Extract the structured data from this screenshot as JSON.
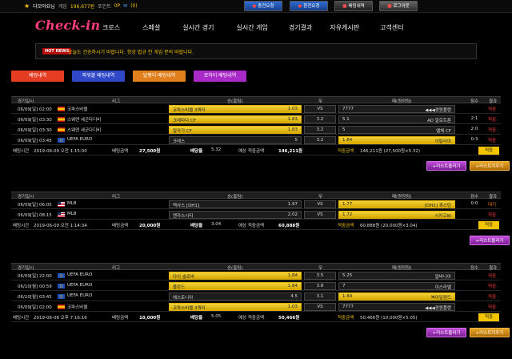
{
  "topbar": {
    "username": "다모아요님",
    "money_label": "게임",
    "money": "196,677원",
    "point_label": "포인트",
    "point": "0P",
    "message_count": "(0)",
    "buttons": {
      "charge": "충전요청",
      "exchange": "환전요청",
      "betlist": "배팅내역",
      "logout": "로그아웃"
    }
  },
  "nav": {
    "logo": "Check-in",
    "menu": [
      "크로스",
      "스페셜",
      "실시간 경기",
      "실시간 게임",
      "경기결과",
      "자유게시판",
      "고객센터"
    ]
  },
  "notice": {
    "tag": "HOT NEWS",
    "text": "오늘도 건승하시기 바랍니다. 항상 법규 전 게임 문의 바랍니다."
  },
  "tabs": [
    "배팅내역",
    "파워볼 배팅내역",
    "달팽이 배팅내역",
    "로하이 배팅내역"
  ],
  "table_headers": {
    "date": "경기일시",
    "league": "리그",
    "home": "승(홈팀)",
    "draw": "무",
    "away": "패(원정팀)",
    "score": "점수",
    "result": "결과"
  },
  "sections": [
    {
      "rows": [
        {
          "date": "06/09[일] 02:00",
          "league": "코파스비렐",
          "home": "코파스비렐 3쿼터",
          "home_odds": "1.03",
          "draw": "VS",
          "away": "7777",
          "away_odds": "",
          "away_team": "◀◀◀경원플랜",
          "pick": "home",
          "score": "",
          "result": "적중"
        },
        {
          "date": "06/09[일] 03:30",
          "league": "스웨덴 세군다디비",
          "home": "크레마다 CF",
          "home_odds": "1.83",
          "draw": "3.2",
          "away": "5.1",
          "away_odds": "",
          "away_team": "AD 알로트룬",
          "pick": "home",
          "score": "2:1",
          "result": "적중"
        },
        {
          "date": "06/09[일] 03:30",
          "league": "스웨덴 세군다디비",
          "home": "말라가 CF",
          "home_odds": "1.83",
          "draw": "3.2",
          "away": "5",
          "away_odds": "",
          "away_team": "엘체 CF",
          "pick": "home",
          "score": "2:0",
          "result": "적중"
        },
        {
          "date": "06/09[일] 03:45",
          "league": "UEFA EURO",
          "home": "크레스",
          "home_odds": "5",
          "draw": "3.2",
          "away": "1.84",
          "away_odds": "",
          "away_team": "이탈리아",
          "pick": "away",
          "score": "0:3",
          "result": "적중"
        }
      ],
      "summary": {
        "bet_time_label": "배팅시간",
        "bet_time": "2019-06-09 오전 1:15:00",
        "amount_label": "배팅금액",
        "amount": "27,500원",
        "odds_label": "배당율",
        "odds": "5.32",
        "expected_label": "예상 적중금액",
        "expected": "146,211원",
        "win_label": "적중금액",
        "win": "146,211원 (27,500원×5.32)",
        "status": "적중"
      },
      "actions": {
        "add": "+리스트올리기",
        "del": "+리스트지우기"
      }
    },
    {
      "rows": [
        {
          "date": "06/09[일] 06:05",
          "league": "MLB",
          "home": "텍사스 [DH1]",
          "home_odds": "1.97",
          "draw": "VS",
          "away": "1.77",
          "away_odds": "",
          "away_team": "[DH1] 휴스턴",
          "pick": "away",
          "score": "0:0",
          "result": "대기"
        },
        {
          "date": "06/09[일] 08:15",
          "league": "MLB",
          "home": "캔자스시티",
          "home_odds": "2.02",
          "draw": "VS",
          "away": "1.72",
          "away_odds": "",
          "away_team": "시카고W",
          "pick": "away",
          "score": "",
          "result": "적중"
        }
      ],
      "summary": {
        "bet_time_label": "배팅시간",
        "bet_time": "2019-06-09 오전 1:14:34",
        "amount_label": "배팅금액",
        "amount": "20,000원",
        "odds_label": "배당율",
        "odds": "3.04",
        "expected_label": "예상 적중금액",
        "expected": "60,888원",
        "win_label": "적중금액",
        "win": "60,888원 (20,000원×3.04)",
        "status": "적중"
      },
      "actions": {
        "add": "+리스트올리기"
      }
    },
    {
      "rows": [
        {
          "date": "06/09[일] 22:00",
          "league": "UEFA EURO",
          "home": "다이 슬로바",
          "home_odds": "1.84",
          "draw": "3.5",
          "away": "5.25",
          "away_odds": "",
          "away_team": "알바니아",
          "pick": "home",
          "score": "",
          "result": "적중"
        },
        {
          "date": "06/10[월] 00:59",
          "league": "UEFA EURO",
          "home": "폴란드",
          "home_odds": "1.84",
          "draw": "3.8",
          "away": "7",
          "away_odds": "",
          "away_team": "이스라엘",
          "pick": "home",
          "score": "",
          "result": "적중"
        },
        {
          "date": "06/10[월] 03:45",
          "league": "UEFA EURO",
          "home": "에스토니아",
          "home_odds": "4.5",
          "draw": "3.1",
          "away": "1.84",
          "away_odds": "",
          "away_team": "북아일랜드",
          "pick": "away",
          "score": "",
          "result": "적중"
        },
        {
          "date": "06/09[일] 02:00",
          "league": "코파스비렐",
          "home": "코파스비렐 3쿼터",
          "home_odds": "1.03",
          "draw": "VS",
          "away": "7777",
          "away_odds": "",
          "away_team": "◀◀◀경원플랜",
          "pick": "home",
          "score": "",
          "result": "적중"
        }
      ],
      "summary": {
        "bet_time_label": "배팅시간",
        "bet_time": "2019-06-08 오후 7:16:16",
        "amount_label": "배팅금액",
        "amount": "10,000원",
        "odds_label": "배당율",
        "odds": "5.05",
        "expected_label": "예상 적중금액",
        "expected": "50,466원",
        "win_label": "적중금액",
        "win": "50,466원 (10,000원×5.05)",
        "status": "적중"
      },
      "actions": {
        "add": "+리스트올리기",
        "del": "+리스트지우기"
      }
    }
  ]
}
